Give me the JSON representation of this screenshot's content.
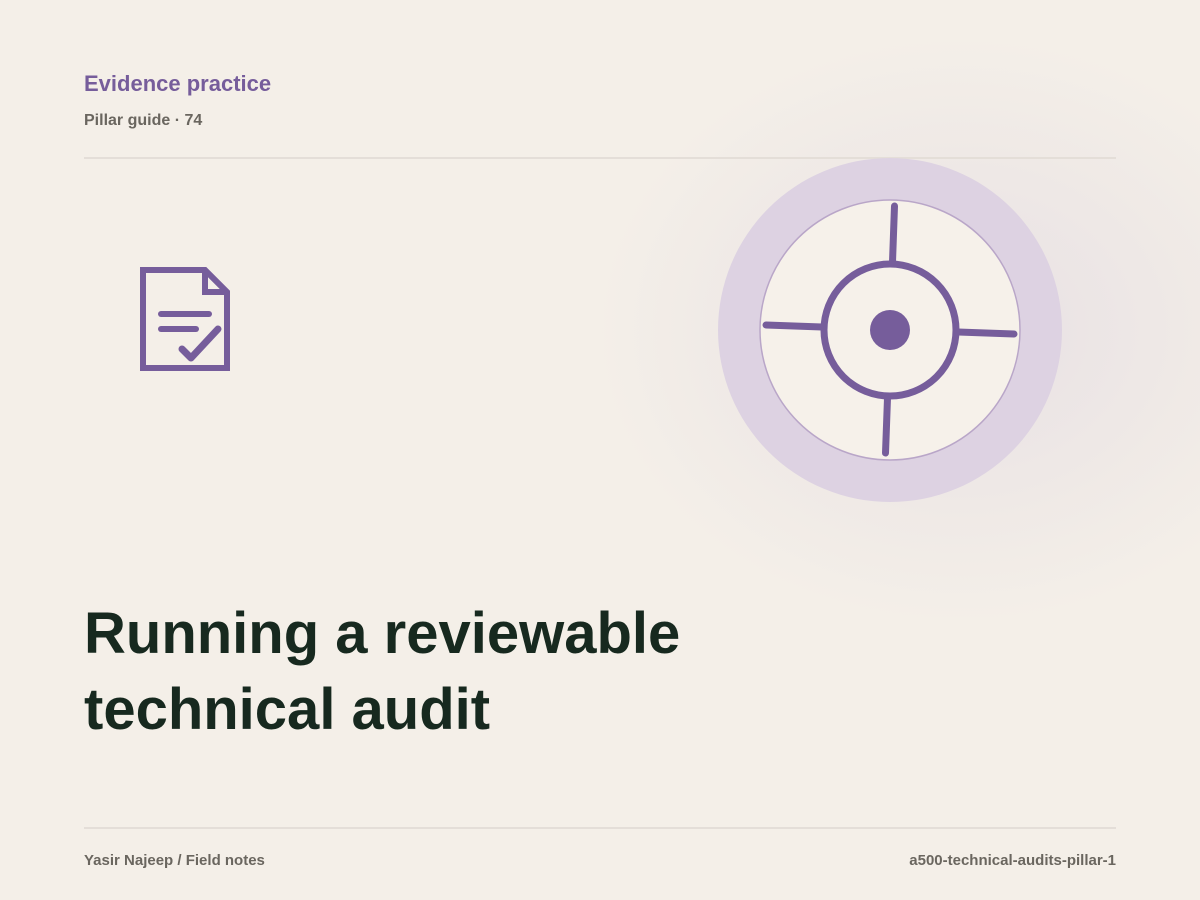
{
  "header": {
    "kicker": "Evidence practice",
    "meta": "Pillar guide · 74"
  },
  "icons": {
    "document": "document-check-icon",
    "target": "target-crosshair-icon"
  },
  "main": {
    "title": "Running a reviewable technical audit"
  },
  "footer": {
    "byline": "Yasir Najeep / Field notes",
    "slug": "a500-technical-audits-pillar-1"
  },
  "colors": {
    "accent": "#765d9b",
    "title": "#17291f",
    "muted": "#6a665f",
    "background": "#f4efe8",
    "halo": "#ddd2e2"
  }
}
